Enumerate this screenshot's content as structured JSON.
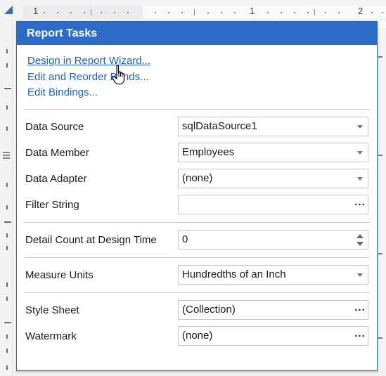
{
  "ruler": {
    "marks": [
      "1",
      "1",
      "2"
    ]
  },
  "panel": {
    "title": "Report Tasks",
    "links": [
      {
        "label": "Design in Report Wizard..."
      },
      {
        "label": "Edit and Reorder Bands..."
      },
      {
        "label": "Edit Bindings..."
      }
    ],
    "properties": {
      "data_source": {
        "label": "Data Source",
        "value": "sqlDataSource1"
      },
      "data_member": {
        "label": "Data Member",
        "value": "Employees"
      },
      "data_adapter": {
        "label": "Data Adapter",
        "value": "(none)"
      },
      "filter_string": {
        "label": "Filter String",
        "value": ""
      },
      "detail_count": {
        "label": "Detail Count at Design Time",
        "value": "0"
      },
      "measure_units": {
        "label": "Measure Units",
        "value": "Hundredths of an Inch"
      },
      "style_sheet": {
        "label": "Style Sheet",
        "value": "(Collection)"
      },
      "watermark": {
        "label": "Watermark",
        "value": "(none)"
      }
    }
  },
  "icons": {
    "dropdown": "chevron-down-icon",
    "ellipsis": "ellipsis-icon",
    "spinner": "spinner-icon",
    "cursor": "hand-pointer-icon"
  },
  "colors": {
    "accent": "#2d6bc8",
    "link": "#1d5fbe"
  }
}
